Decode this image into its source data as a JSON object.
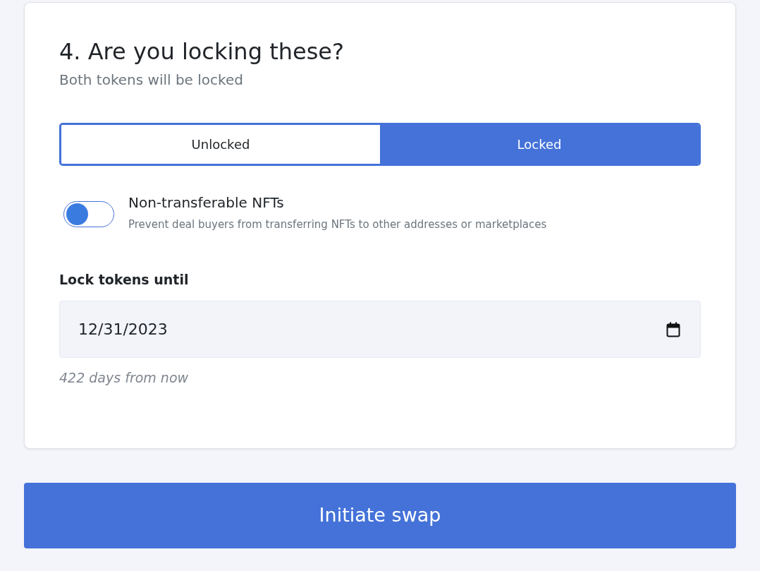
{
  "section": {
    "title": "4. Are you locking these?",
    "subtitle": "Both tokens will be locked"
  },
  "lock_options": [
    {
      "label": "Unlocked",
      "selected": false
    },
    {
      "label": "Locked",
      "selected": true
    }
  ],
  "non_transferable": {
    "label": "Non-transferable NFTs",
    "description": "Prevent deal buyers from transferring NFTs to other addresses or marketplaces",
    "on": false
  },
  "lock_until": {
    "label": "Lock tokens until",
    "value": "12/31/2023",
    "hint": "422 days from now"
  },
  "submit_button": "Initiate swap"
}
